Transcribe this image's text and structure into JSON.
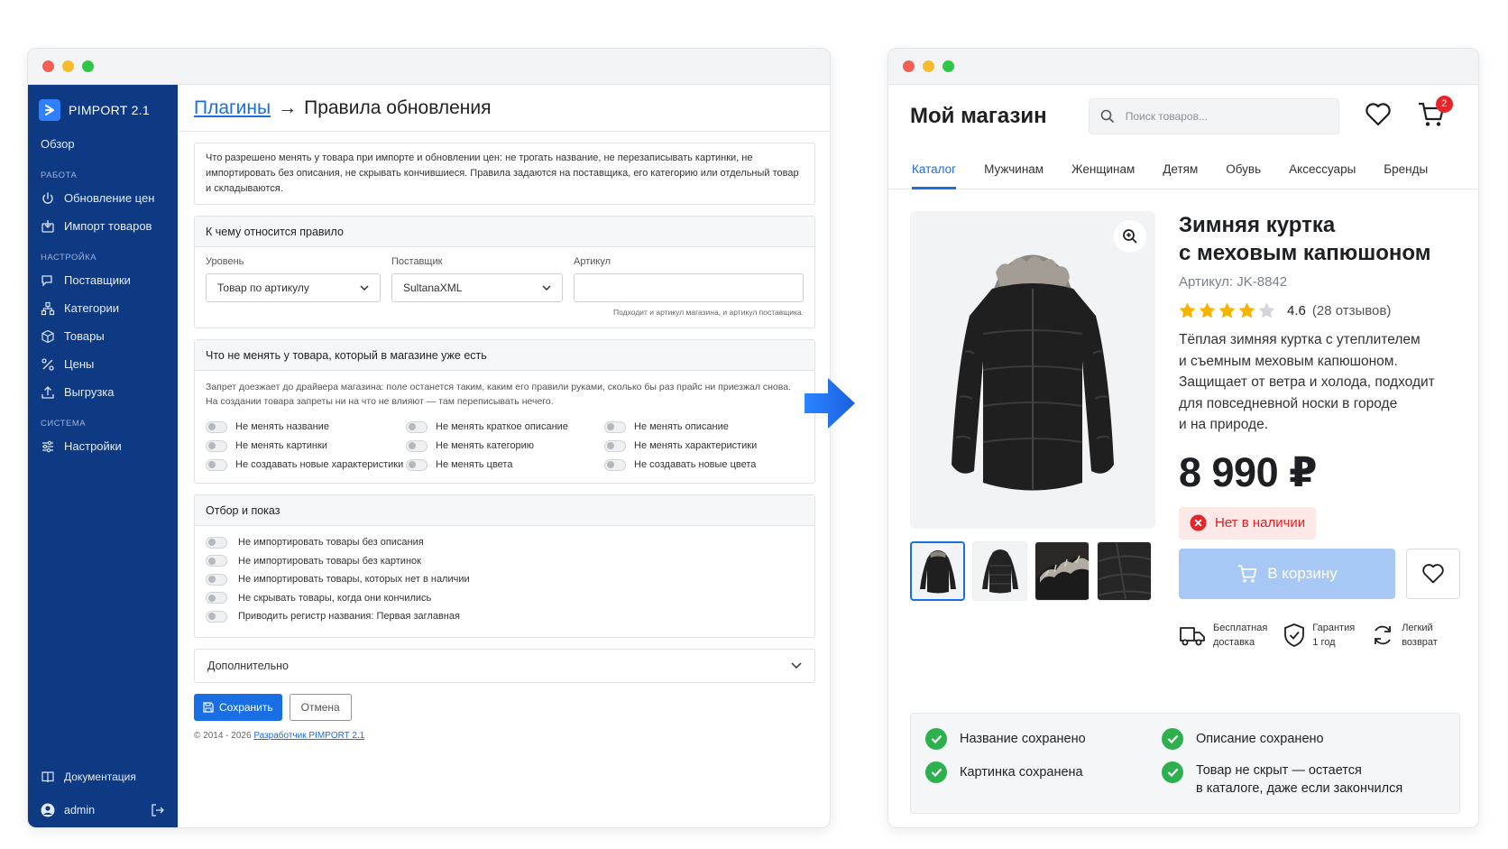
{
  "admin": {
    "brand": "PIMPORT 2.1",
    "overview": "Обзор",
    "section_work": "РАБОТА",
    "menu_work": [
      "Обновление цен",
      "Импорт товаров"
    ],
    "section_settings": "НАСТРОЙКА",
    "menu_settings": [
      "Поставщики",
      "Категории",
      "Товары",
      "Цены",
      "Выгрузка"
    ],
    "section_system": "СИСТЕМА",
    "menu_system": [
      "Настройки"
    ],
    "docs": "Документация",
    "user": "admin",
    "breadcrumb_link": "Плагины",
    "breadcrumb_arrow": "→",
    "page_title": "Правила обновления",
    "info_text": "Что разрешено менять у товара при импорте и обновлении цен: не трогать название, не перезаписывать картинки, не импортировать без описания, не скрывать кончившиеся. Правила задаются на поставщика, его категорию или отдельный товар и складываются.",
    "scope_panel": {
      "title": "К чему относится правило",
      "level_label": "Уровень",
      "level_value": "Товар по артикулу",
      "supplier_label": "Поставщик",
      "supplier_value": "SultanaXML",
      "sku_label": "Артикул",
      "sku_value": "",
      "sku_hint": "Подходит и артикул магазина, и артикул поставщика."
    },
    "keep_panel": {
      "title": "Что не менять у товара, который в магазине уже есть",
      "description": "Запрет доезжает до драйвера магазина: поле останется таким, каким его правили руками, сколько бы раз прайс ни приезжал снова. На создании товара запреты ни на что не влияют — там переписывать нечего.",
      "toggles": [
        "Не менять название",
        "Не менять краткое описание",
        "Не менять описание",
        "Не менять картинки",
        "Не менять категорию",
        "Не менять характеристики",
        "Не создавать новые характеристики",
        "Не менять цвета",
        "Не создавать новые цвета"
      ]
    },
    "filter_panel": {
      "title": "Отбор и показ",
      "toggles": [
        "Не импортировать товары без описания",
        "Не импортировать товары без картинок",
        "Не импортировать товары, которых нет в наличии",
        "Не скрывать товары, когда они кончились",
        "Приводить регистр названия: Первая заглавная"
      ]
    },
    "extra_label": "Дополнительно",
    "save_label": "Сохранить",
    "cancel_label": "Отмена",
    "footer_text": "© 2014 - 2026",
    "footer_link": "Разработчик PIMPORT 2.1"
  },
  "store": {
    "name": "Мой магазин",
    "search_placeholder": "Поиск товаров...",
    "cart_count": "2",
    "tabs": [
      "Каталог",
      "Мужчинам",
      "Женщинам",
      "Детям",
      "Обувь",
      "Аксессуары",
      "Бренды"
    ],
    "active_tab": "Каталог",
    "product": {
      "title_line1": "Зимняя куртка",
      "title_line2": "с меховым капюшоном",
      "sku": "Артикул: JK-8842",
      "rating_stars": 4,
      "rating_value": "4.6",
      "reviews": "(28 отзывов)",
      "desc_lines": [
        "Тёплая зимняя куртка с утеплителем",
        "и съемным меховым капюшоном.",
        "Защищает от ветра и холода, подходит",
        "для повседневной носки в городе",
        "и на природе."
      ],
      "price": "8 990 ₽",
      "stock_status": "Нет в наличии",
      "cart_button": "В корзину"
    },
    "perks": [
      {
        "line1": "Бесплатная",
        "line2": "доставка",
        "icon": "truck-icon"
      },
      {
        "line1": "Гарантия",
        "line2": "1 год",
        "icon": "shield-icon"
      },
      {
        "line1": "Легкий",
        "line2": "возврат",
        "icon": "refresh-icon"
      }
    ],
    "saved": [
      {
        "line1": "Название сохранено",
        "line2": ""
      },
      {
        "line1": "Описание сохранено",
        "line2": ""
      },
      {
        "line1": "Картинка сохранена",
        "line2": ""
      },
      {
        "line1": "Товар не скрыт — остается",
        "line2": "в каталоге, даже если закончился"
      }
    ]
  },
  "colors": {
    "sidebar": "#0d3a82",
    "accent": "#1a6ee3",
    "cart_badge": "#e5252a",
    "success": "#2fb04f",
    "star": "#f5b400",
    "arrow": "#1f6ff5"
  }
}
